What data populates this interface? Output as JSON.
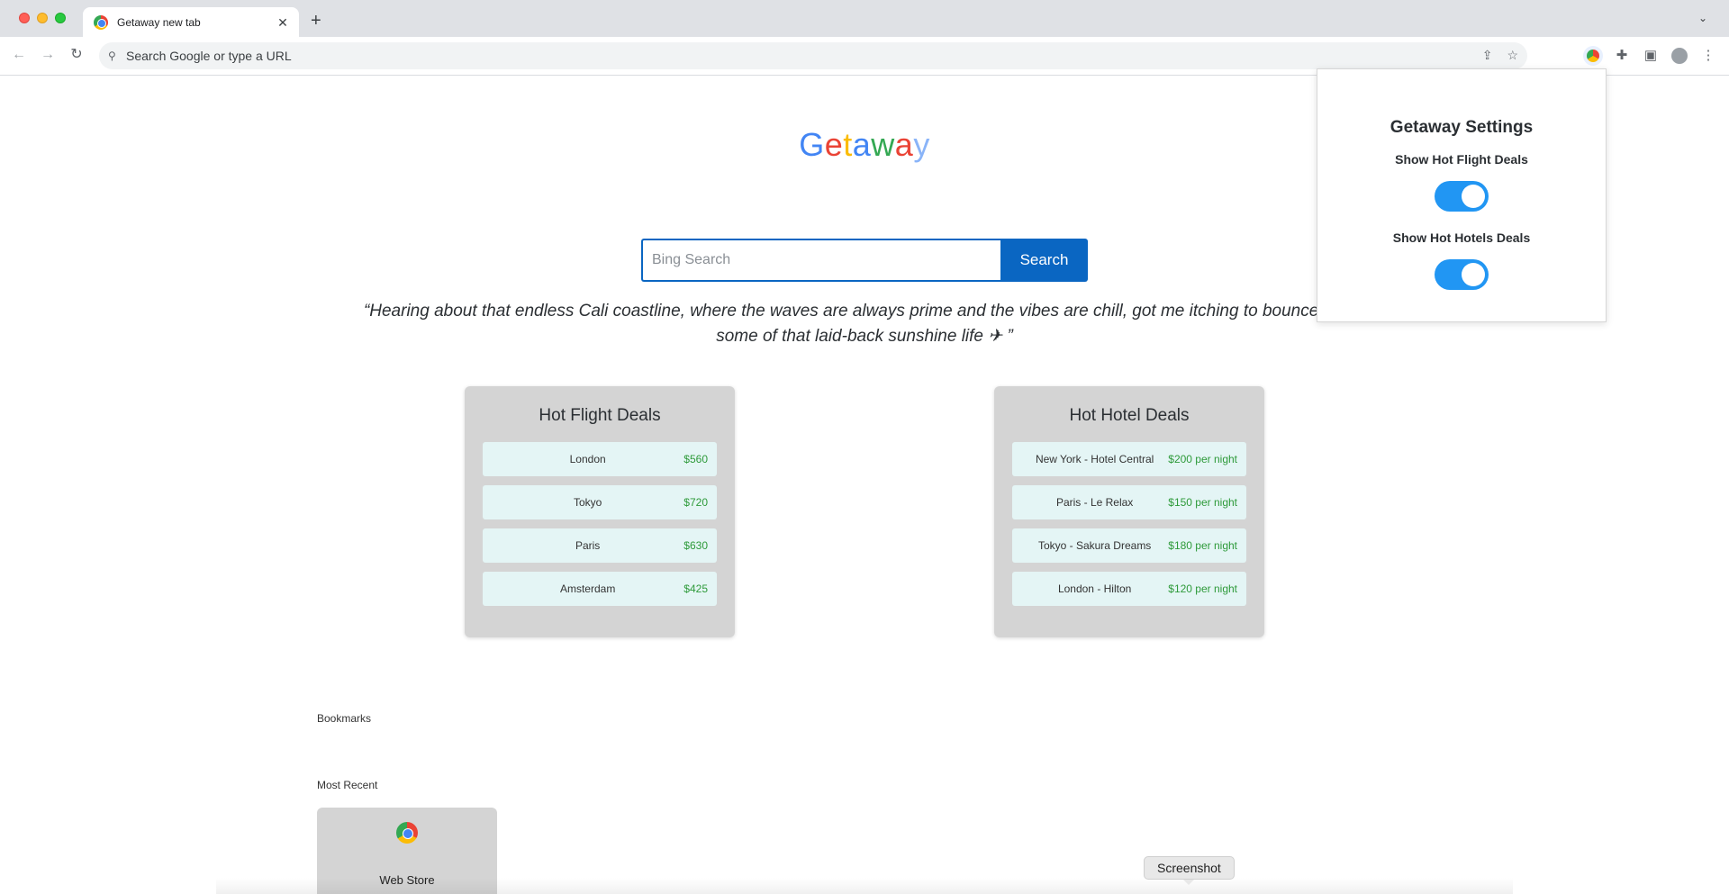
{
  "browser": {
    "tab_title": "Getaway new tab",
    "omnibox_placeholder": "Search Google or type a URL"
  },
  "logo": {
    "letters": [
      "G",
      "e",
      "t",
      "a",
      "w",
      "a",
      "y"
    ],
    "colors": [
      "#4285f4",
      "#ea4335",
      "#fbbc05",
      "#4285f4",
      "#34a853",
      "#ea4335",
      "#8ab4f8"
    ]
  },
  "search": {
    "placeholder": "Bing Search",
    "button_label": "Search"
  },
  "quote": "“Hearing about that endless Cali coastline, where the waves are always prime and the vibes are chill, got me itching to bounce and s",
  "quote_line2": "some of that laid-back sunshine life ✈ ”",
  "flights": {
    "title": "Hot Flight Deals",
    "items": [
      {
        "name": "London",
        "price": "$560"
      },
      {
        "name": "Tokyo",
        "price": "$720"
      },
      {
        "name": "Paris",
        "price": "$630"
      },
      {
        "name": "Amsterdam",
        "price": "$425"
      }
    ]
  },
  "hotels": {
    "title": "Hot Hotel Deals",
    "items": [
      {
        "name": "New York - Hotel Central",
        "price": "$200 per night"
      },
      {
        "name": "Paris - Le Relax",
        "price": "$150 per night"
      },
      {
        "name": "Tokyo - Sakura Dreams",
        "price": "$180 per night"
      },
      {
        "name": "London - Hilton",
        "price": "$120 per night"
      }
    ]
  },
  "bookmarks_label": "Bookmarks",
  "most_recent_label": "Most Recent",
  "most_recent": [
    {
      "label": "Web Store",
      "icon": "chrome-icon"
    }
  ],
  "tooltip": "Screenshot",
  "popup": {
    "title": "Getaway Settings",
    "toggles": [
      {
        "label": "Show Hot Flight Deals",
        "on": true
      },
      {
        "label": "Show Hot Hotels Deals",
        "on": true
      }
    ]
  },
  "accent_color": "#0a66c2",
  "toggle_color": "#2196f3"
}
